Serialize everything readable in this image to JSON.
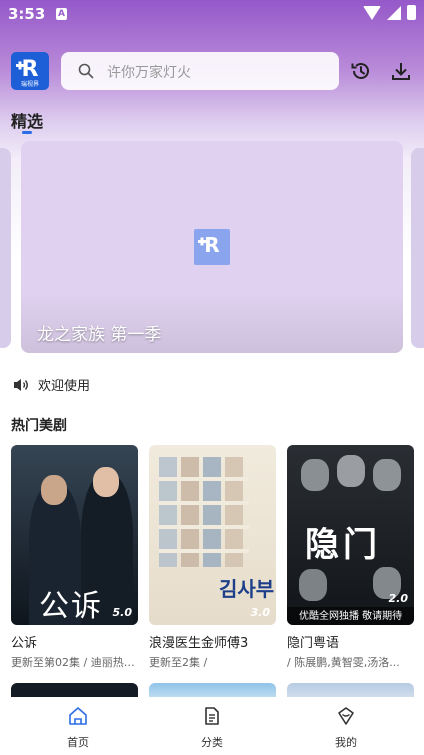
{
  "status_bar": {
    "time": "3:53",
    "notification_glyph": "A"
  },
  "header": {
    "logo_text": "瑞视界",
    "search_placeholder": "许你万家灯火",
    "icons": [
      "history-icon",
      "download-icon"
    ]
  },
  "tabs": [
    {
      "label": "精选",
      "selected": true
    }
  ],
  "banner": {
    "title": "龙之家族 第一季"
  },
  "notice": {
    "text": "欢迎使用"
  },
  "section": {
    "title": "热门美剧"
  },
  "cards": [
    {
      "title": "公诉",
      "subtitle": "更新至第02集 / 迪丽热巴...",
      "rating": "5.0",
      "poster_text": "公诉"
    },
    {
      "title": "浪漫医生金师傅3",
      "subtitle": "更新至2集 /",
      "rating": "3.0",
      "poster_text": "김사부"
    },
    {
      "title": "隐门粤语",
      "subtitle": "/ 陈展鹏,黄智雯,汤洛...",
      "rating": "2.0",
      "poster_text": "隐门",
      "poster_banner": "优酷全网独播 敬请期待"
    }
  ],
  "bottom_nav": [
    {
      "label": "首页",
      "icon": "home-icon",
      "active": true
    },
    {
      "label": "分类",
      "icon": "category-icon",
      "active": false
    },
    {
      "label": "我的",
      "icon": "profile-icon",
      "active": false
    }
  ],
  "colors": {
    "accent": "#2b6de6",
    "header_gradient": "#9558c9",
    "logo_bg": "#1e5fd8"
  }
}
